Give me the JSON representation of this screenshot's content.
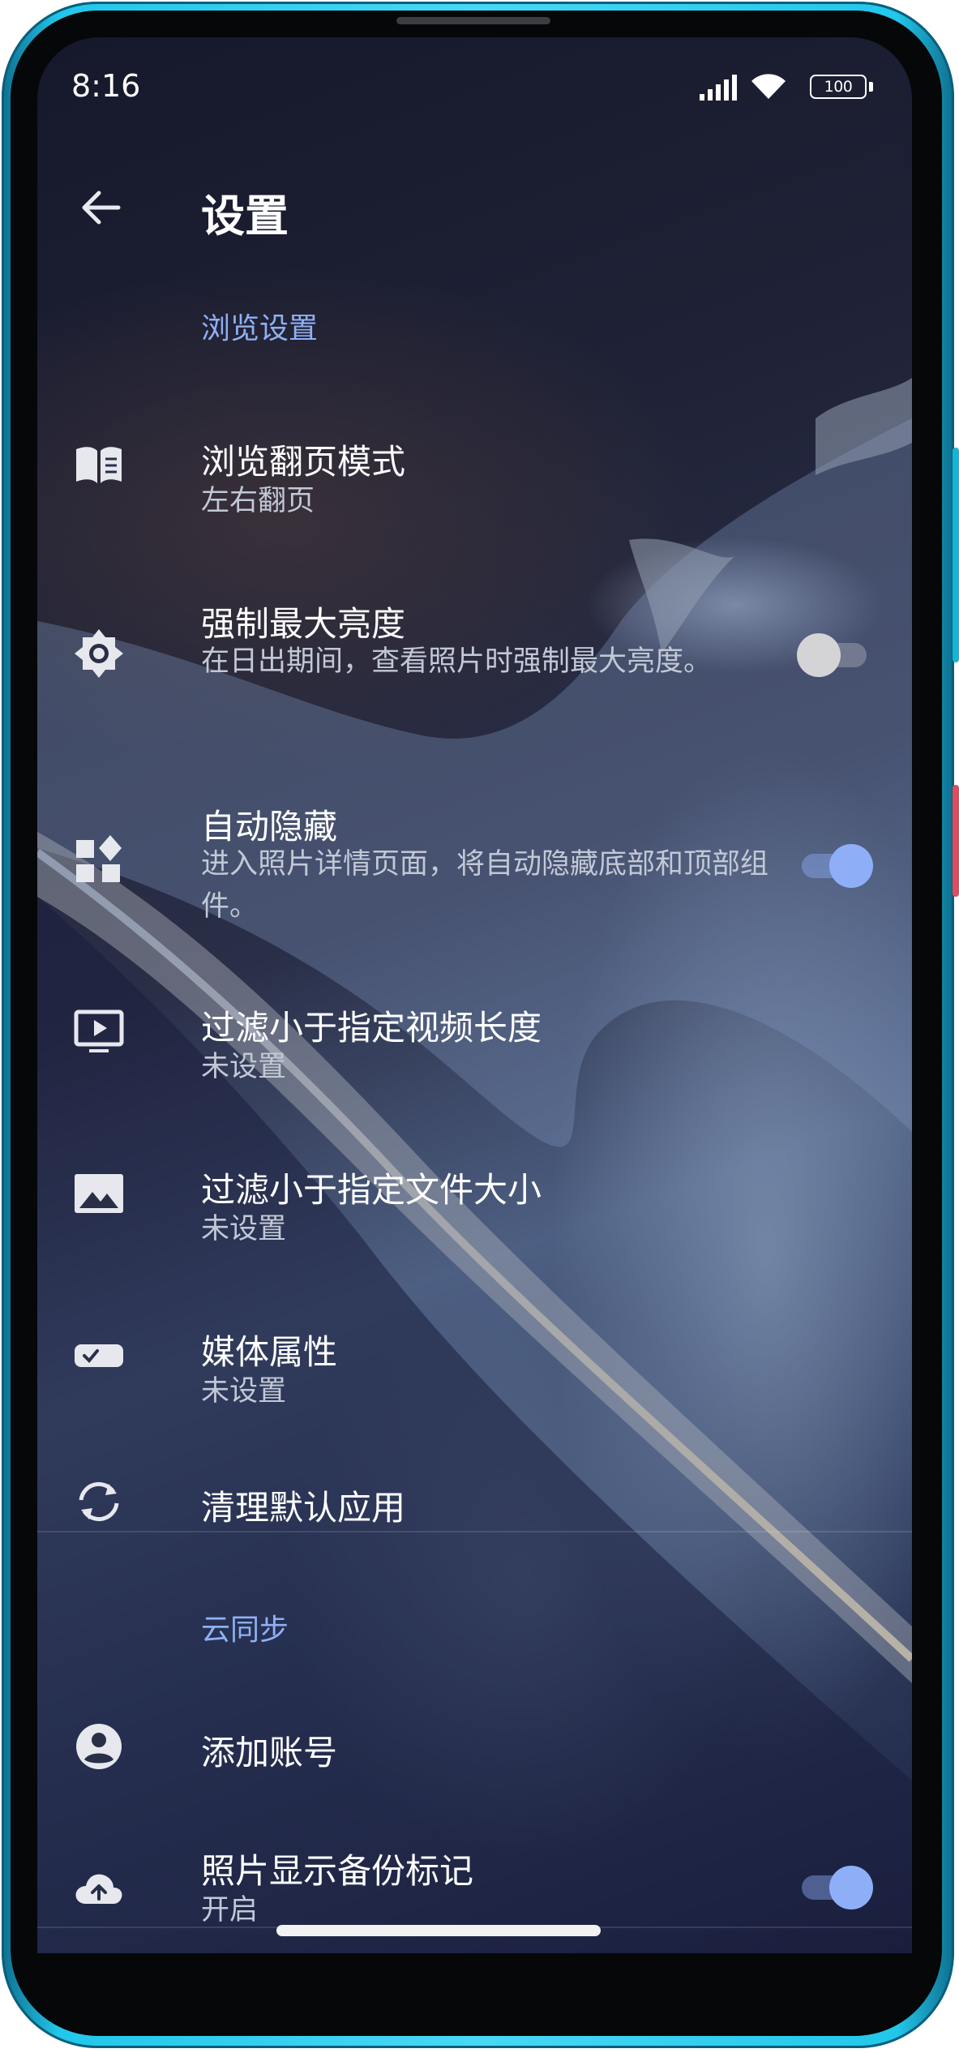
{
  "status_bar": {
    "time": "8:16",
    "battery": "100",
    "icons": [
      "signal-icon",
      "wifi-icon",
      "battery-icon"
    ]
  },
  "header": {
    "back_icon": "arrow-back-icon",
    "title": "设置"
  },
  "sections": {
    "browse": {
      "header": "浏览设置",
      "items": [
        {
          "icon": "book-icon",
          "title": "浏览翻页模式",
          "subtitle": "左右翻页"
        },
        {
          "icon": "brightness-icon",
          "title": "强制最大亮度",
          "subtitle": "在日出期间，查看照片时强制最大亮度。",
          "toggle": false
        },
        {
          "icon": "widgets-icon",
          "title": "自动隐藏",
          "subtitle": "进入照片详情页面，将自动隐藏底部和顶部组件。",
          "toggle": true
        },
        {
          "icon": "video-icon",
          "title": "过滤小于指定视频长度",
          "subtitle": "未设置"
        },
        {
          "icon": "image-icon",
          "title": "过滤小于指定文件大小",
          "subtitle": "未设置"
        },
        {
          "icon": "media-badge-icon",
          "title": "媒体属性",
          "subtitle": "未设置"
        },
        {
          "icon": "sync-icon",
          "title": "清理默认应用"
        }
      ]
    },
    "cloud": {
      "header": "云同步",
      "items": [
        {
          "icon": "account-icon",
          "title": "添加账号"
        },
        {
          "icon": "cloud-upload-icon",
          "title": "照片显示备份标记",
          "subtitle": "开启",
          "toggle": true
        }
      ]
    }
  },
  "colors": {
    "accent": "#8fb0f5",
    "toggle_on": "#8eaff8",
    "toggle_off": "#d4d4d6",
    "frame": "#22c7ea"
  }
}
